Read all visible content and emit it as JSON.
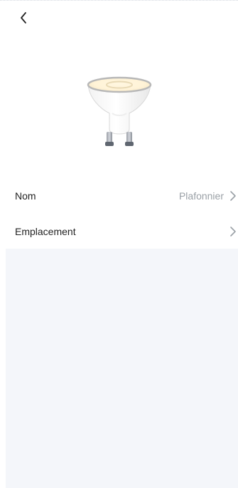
{
  "header": {
    "back_icon": "chevron-left-icon"
  },
  "device": {
    "image": "gu10-bulb-illustration"
  },
  "settings": {
    "items": [
      {
        "label": "Nom",
        "value": "Plafonnier",
        "icon": "chevron-right-icon"
      },
      {
        "label": "Emplacement",
        "value": "",
        "icon": "chevron-right-icon"
      }
    ]
  },
  "colors": {
    "background": "#ffffff",
    "text_primary": "#222222",
    "text_secondary": "#9aa0a6",
    "panel": "#f4f6fa"
  }
}
